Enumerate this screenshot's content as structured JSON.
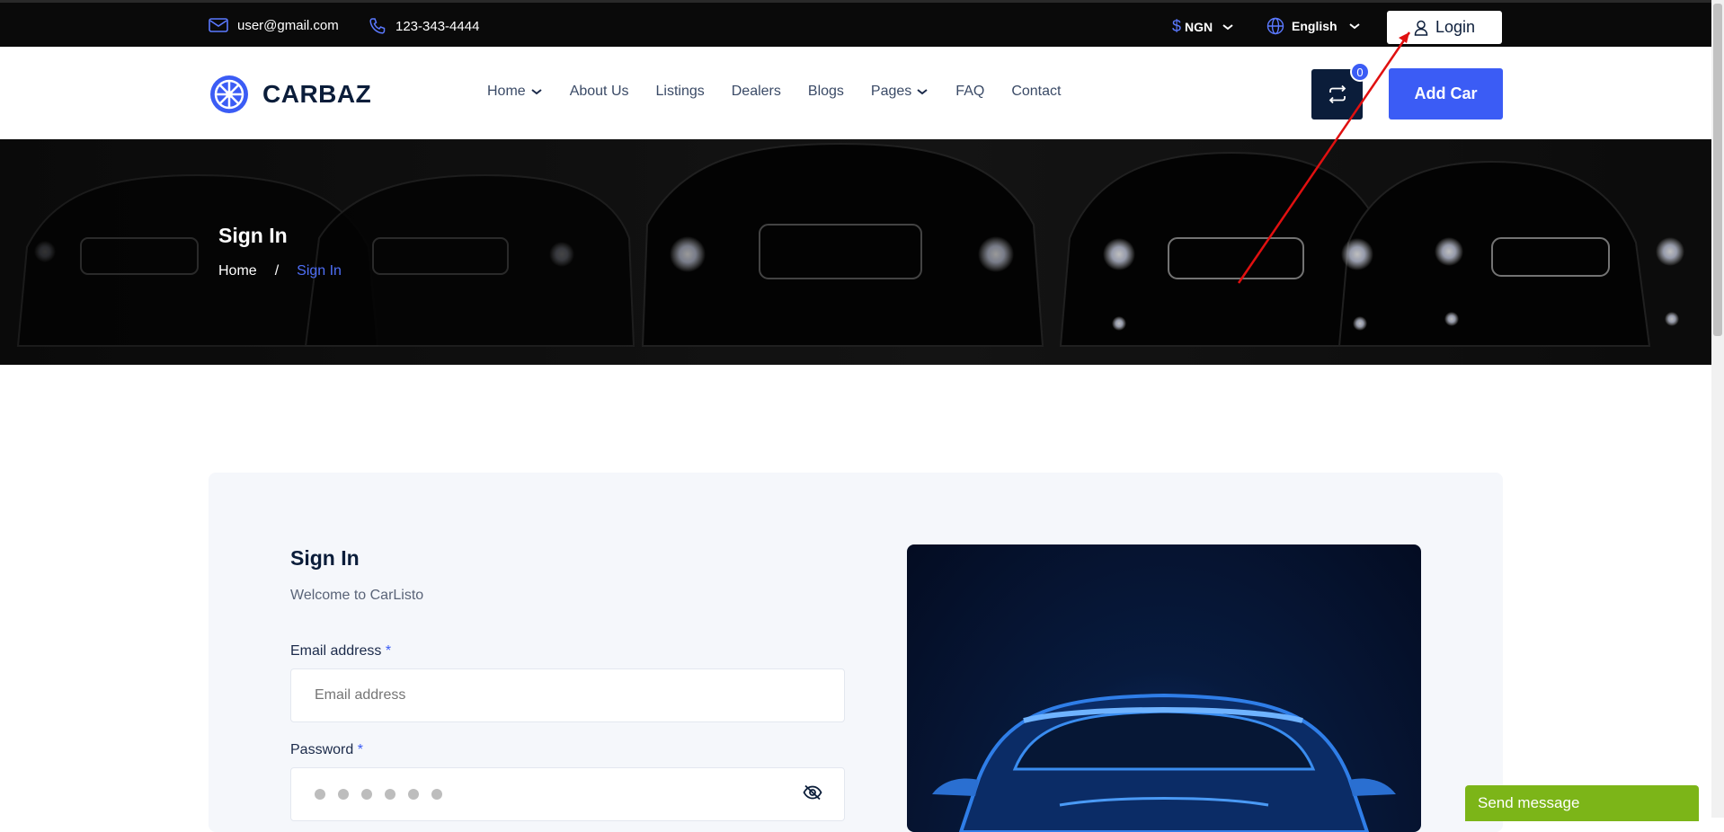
{
  "topbar": {
    "email": "user@gmail.com",
    "phone": "123-343-4444",
    "currency": "NGN",
    "language": "English",
    "login_label": "Login"
  },
  "nav": {
    "brand": "CARBAZ",
    "links": [
      "Home",
      "About Us",
      "Listings",
      "Dealers",
      "Blogs",
      "Pages",
      "FAQ",
      "Contact"
    ],
    "compare_count": "0",
    "add_car_label": "Add Car"
  },
  "hero": {
    "title": "Sign In",
    "breadcrumb_home": "Home",
    "breadcrumb_sep": "/",
    "breadcrumb_current": "Sign In"
  },
  "form": {
    "title": "Sign In",
    "subtitle": "Welcome to CarListo",
    "email_label": "Email address",
    "email_placeholder": "Email address",
    "password_label": "Password",
    "required_mark": "*"
  },
  "chat": {
    "label": "Send message"
  },
  "colors": {
    "accent": "#3b5cf5",
    "navy": "#0b1d3a",
    "chat_green": "#7cb518"
  }
}
